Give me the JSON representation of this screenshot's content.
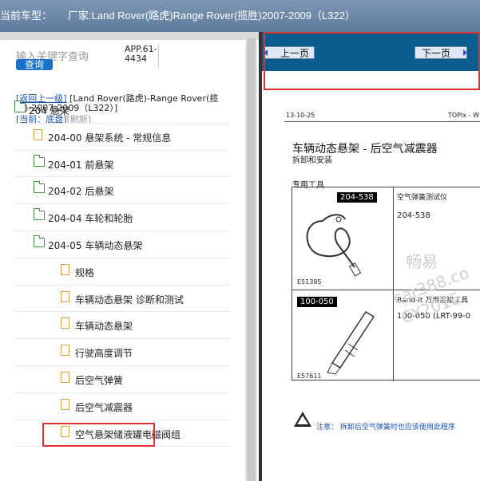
{
  "titlebar": {
    "label": "当前车型：",
    "maker": "厂家:Land Rover(路虎)Range Rover(揽胜)2007-2009（L322）"
  },
  "search": {
    "placeholder": "输入关键字查询",
    "button": "查询"
  },
  "app_id": "APP.61-4434",
  "nav": {
    "back": "[返回上一级]",
    "vehicle": "[Land Rover(路虎)-Range Rover(揽胜)-2007-2009（L322）]",
    "current_label": "[当前：底盘]",
    "refresh": "[刷新]"
  },
  "tree": [
    {
      "label": "204 悬架",
      "type": "folder",
      "level": 0
    },
    {
      "label": "204-00 悬架系统 - 常规信息",
      "type": "file",
      "level": 1
    },
    {
      "label": "204-01 前悬架",
      "type": "folder",
      "level": 1
    },
    {
      "label": "204-02 后悬架",
      "type": "folder",
      "level": 1
    },
    {
      "label": "204-04 车轮和轮胎",
      "type": "folder",
      "level": 1
    },
    {
      "label": "204-05 车辆动态悬架",
      "type": "folder",
      "level": 1
    },
    {
      "label": "规格",
      "type": "file",
      "level": 2
    },
    {
      "label": "车辆动态悬架 诊断和测试",
      "type": "file",
      "level": 2
    },
    {
      "label": "车辆动态悬架",
      "type": "file",
      "level": 2
    },
    {
      "label": "行驶高度调节",
      "type": "file",
      "level": 2
    },
    {
      "label": "后空气弹簧",
      "type": "file",
      "level": 2
    },
    {
      "label": "后空气减震器",
      "type": "file",
      "level": 2,
      "selected": true
    },
    {
      "label": "空气悬架储液罐电磁阀组",
      "type": "file",
      "level": 2
    }
  ],
  "pager": {
    "prev": "上一页",
    "next": "下一页"
  },
  "doc": {
    "date": "13-10-25",
    "header_right": "TOPIx - W",
    "title": "车辆动态悬架 - 后空气减震器",
    "subtitle": "拆卸和安装",
    "tools_label": "专用工具",
    "tool1": {
      "tag": "204-538",
      "fig": "E51385",
      "name": "空气弹簧测试仪",
      "code": "204-538"
    },
    "tool2": {
      "tag": "100-050",
      "fig": "E57611",
      "name": "Band-it 万用连接工具",
      "code": "100-050 (LRT-99-0"
    },
    "warning": "注意：  拆卸后空气弹簧时也应该使用此程序"
  },
  "watermark": {
    "line1": "畅易",
    "line2": "car388.co",
    "line3": "CY2016"
  }
}
